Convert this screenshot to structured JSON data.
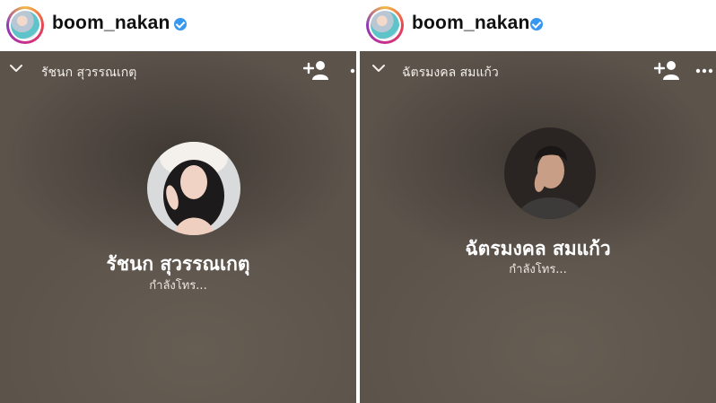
{
  "colors": {
    "call_background": "#5c534b",
    "verified_badge": "#3897f0",
    "header_background": "#ffffff"
  },
  "panels": [
    {
      "header": {
        "username": "boom_nakan",
        "verified": true,
        "avatar_icon": "profile-avatar"
      },
      "call": {
        "top_name": "รัชนก สุวรรณเกตุ",
        "callee_name": "รัชนก สุวรรณเกตุ",
        "status": "กำลังโทร...",
        "icons": [
          "chevron-down-icon",
          "add-person-icon",
          "more-dots-icon"
        ]
      }
    },
    {
      "header": {
        "username": "boom_nakan",
        "verified": true,
        "avatar_icon": "profile-avatar"
      },
      "call": {
        "top_name": "ฉัตรมงคล สมแก้ว",
        "callee_name": "ฉัตรมงคล สมแก้ว",
        "status": "กำลังโทร...",
        "icons": [
          "chevron-down-icon",
          "add-person-icon",
          "more-dots-icon"
        ]
      }
    }
  ]
}
